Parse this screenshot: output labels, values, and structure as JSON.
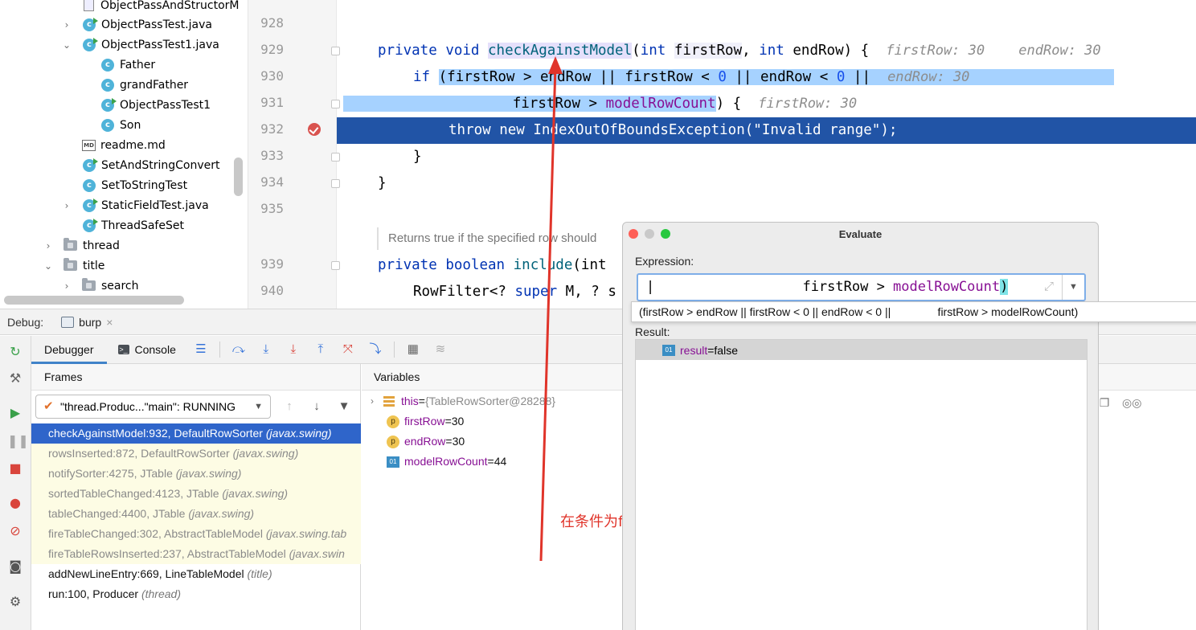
{
  "tree": {
    "items": [
      {
        "label": "ObjectPassAndStructorM",
        "type": "doc"
      },
      {
        "label": "ObjectPassTest.java",
        "type": "class-run",
        "chevron": "›"
      },
      {
        "label": "ObjectPassTest1.java",
        "type": "class-run",
        "chevron": "⌄"
      },
      {
        "label": "Father",
        "type": "class"
      },
      {
        "label": "grandFather",
        "type": "class"
      },
      {
        "label": "ObjectPassTest1",
        "type": "class-run"
      },
      {
        "label": "Son",
        "type": "class"
      },
      {
        "label": "readme.md",
        "type": "md"
      },
      {
        "label": "SetAndStringConvert",
        "type": "class-run"
      },
      {
        "label": "SetToStringTest",
        "type": "class"
      },
      {
        "label": "StaticFieldTest.java",
        "type": "class-run",
        "chevron": "›"
      },
      {
        "label": "ThreadSafeSet",
        "type": "class-run"
      },
      {
        "label": "thread",
        "type": "folder",
        "chevron": "›"
      },
      {
        "label": "title",
        "type": "folder",
        "chevron": "⌄"
      },
      {
        "label": "search",
        "type": "folder",
        "chevron": "›"
      }
    ],
    "class_letter": "c",
    "md_letters": "MD"
  },
  "editor": {
    "line_numbers": [
      "928",
      "929",
      "930",
      "931",
      "932",
      "933",
      "934",
      "935",
      "939",
      "940"
    ],
    "line929": {
      "kw1": "private",
      "kw2": "void",
      "method": "checkAgainstModel",
      "p1": "(",
      "kw3": "int",
      "param1": "firstRow",
      "comma": ",",
      "kw4": "int",
      "rest": "endRow) {",
      "hint1": "firstRow: 30",
      "hint2": "endRow: 30"
    },
    "line930": {
      "kw": "if",
      "a": "(firstRow > endRow || firstRow < ",
      "n1": "0",
      "b": " || endRow < ",
      "n2": "0",
      "c": " ||",
      "hint": "endRow: 30"
    },
    "line931": {
      "a": "firstRow > ",
      "fld": "modelRowCount",
      "b": ") {",
      "hint": "firstRow: 30"
    },
    "line932": {
      "text": "throw new IndexOutOfBoundsException(\"Invalid range\");"
    },
    "line933": {
      "text": "}"
    },
    "line934": {
      "text": "}"
    },
    "doc_comment": "Returns true if the specified row should",
    "line939": {
      "kw1": "private",
      "kw2": "boolean",
      "method": "include",
      "rest": "(int"
    },
    "line940": {
      "a": "RowFilter<? ",
      "kw": "super",
      "b": " M, ? s"
    }
  },
  "debug_bar": {
    "label": "Debug:",
    "tab": "burp",
    "close": "×"
  },
  "debugger_tabs": {
    "debugger": "Debugger",
    "console": "Console"
  },
  "frames": {
    "header": "Frames",
    "thread": "\"thread.Produc...\"main\": RUNNING",
    "rows": [
      {
        "method": "checkAgainstModel:932, DefaultRowSorter ",
        "pkg": "(javax.swing)",
        "kind": "cur"
      },
      {
        "method": "rowsInserted:872, DefaultRowSorter ",
        "pkg": "(javax.swing)",
        "kind": "lib"
      },
      {
        "method": "notifySorter:4275, JTable ",
        "pkg": "(javax.swing)",
        "kind": "lib"
      },
      {
        "method": "sortedTableChanged:4123, JTable ",
        "pkg": "(javax.swing)",
        "kind": "lib"
      },
      {
        "method": "tableChanged:4400, JTable ",
        "pkg": "(javax.swing)",
        "kind": "lib"
      },
      {
        "method": "fireTableChanged:302, AbstractTableModel ",
        "pkg": "(javax.swing.tab",
        "kind": "lib"
      },
      {
        "method": "fireTableRowsInserted:237, AbstractTableModel ",
        "pkg": "(javax.swin",
        "kind": "lib"
      },
      {
        "method": "addNewLineEntry:669, LineTableModel ",
        "pkg": "(title)",
        "kind": "user"
      },
      {
        "method": "run:100, Producer ",
        "pkg": "(thread)",
        "kind": "user"
      }
    ]
  },
  "variables": {
    "header": "Variables",
    "rows": [
      {
        "name": "this",
        "eq": " = ",
        "value": "{TableRowSorter@28288}",
        "icon": "list"
      },
      {
        "name": "firstRow",
        "eq": " = ",
        "value": "30",
        "icon": "p"
      },
      {
        "name": "endRow",
        "eq": " = ",
        "value": "30",
        "icon": "p"
      },
      {
        "name": "modelRowCount",
        "eq": " = ",
        "value": "44",
        "icon": "o"
      }
    ],
    "p_letter": "p",
    "o_letter": "01"
  },
  "annotation": "在条件为false时，却抛出了异常，奇怪！",
  "evaluate": {
    "title": "Evaluate",
    "expression_label": "Expression:",
    "expression_prefix": "|                  firstRow > ",
    "expression_field": "modelRowCount",
    "expression_suffix": ")",
    "completion": "(firstRow > endRow || firstRow < 0 || endRow < 0 ||               firstRow > modelRowCount)",
    "result_label": "Result:",
    "result_name": "result",
    "result_eq": " = ",
    "result_value": "false"
  },
  "colors": {
    "selection": "#a6d2ff",
    "exec_line": "#2154a6",
    "annotation": "#e0342a",
    "keyword": "#0033b3",
    "field": "#871094"
  }
}
